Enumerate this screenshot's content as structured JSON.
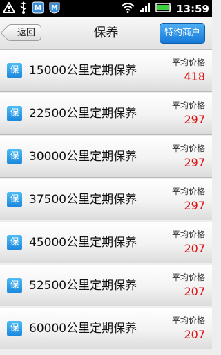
{
  "status_bar": {
    "time": "13:59",
    "icons": [
      "warning-icon",
      "usb-icon",
      "app-notification-icon",
      "app-notification-icon",
      "wifi-icon",
      "signal-icon",
      "battery-icon"
    ]
  },
  "header": {
    "back_label": "返回",
    "title": "保养",
    "merchant_label": "特约商户"
  },
  "list": {
    "badge_label": "保",
    "price_label": "平均价格",
    "items": [
      {
        "title": "15000公里定期保养",
        "price": "418"
      },
      {
        "title": "22500公里定期保养",
        "price": "297"
      },
      {
        "title": "30000公里定期保养",
        "price": "297"
      },
      {
        "title": "37500公里定期保养",
        "price": "297"
      },
      {
        "title": "45000公里定期保养",
        "price": "207"
      },
      {
        "title": "52500公里定期保养",
        "price": "207"
      },
      {
        "title": "60000公里定期保养",
        "price": "207"
      }
    ]
  },
  "colors": {
    "accent": "#1a86dc",
    "price": "#e01010"
  }
}
